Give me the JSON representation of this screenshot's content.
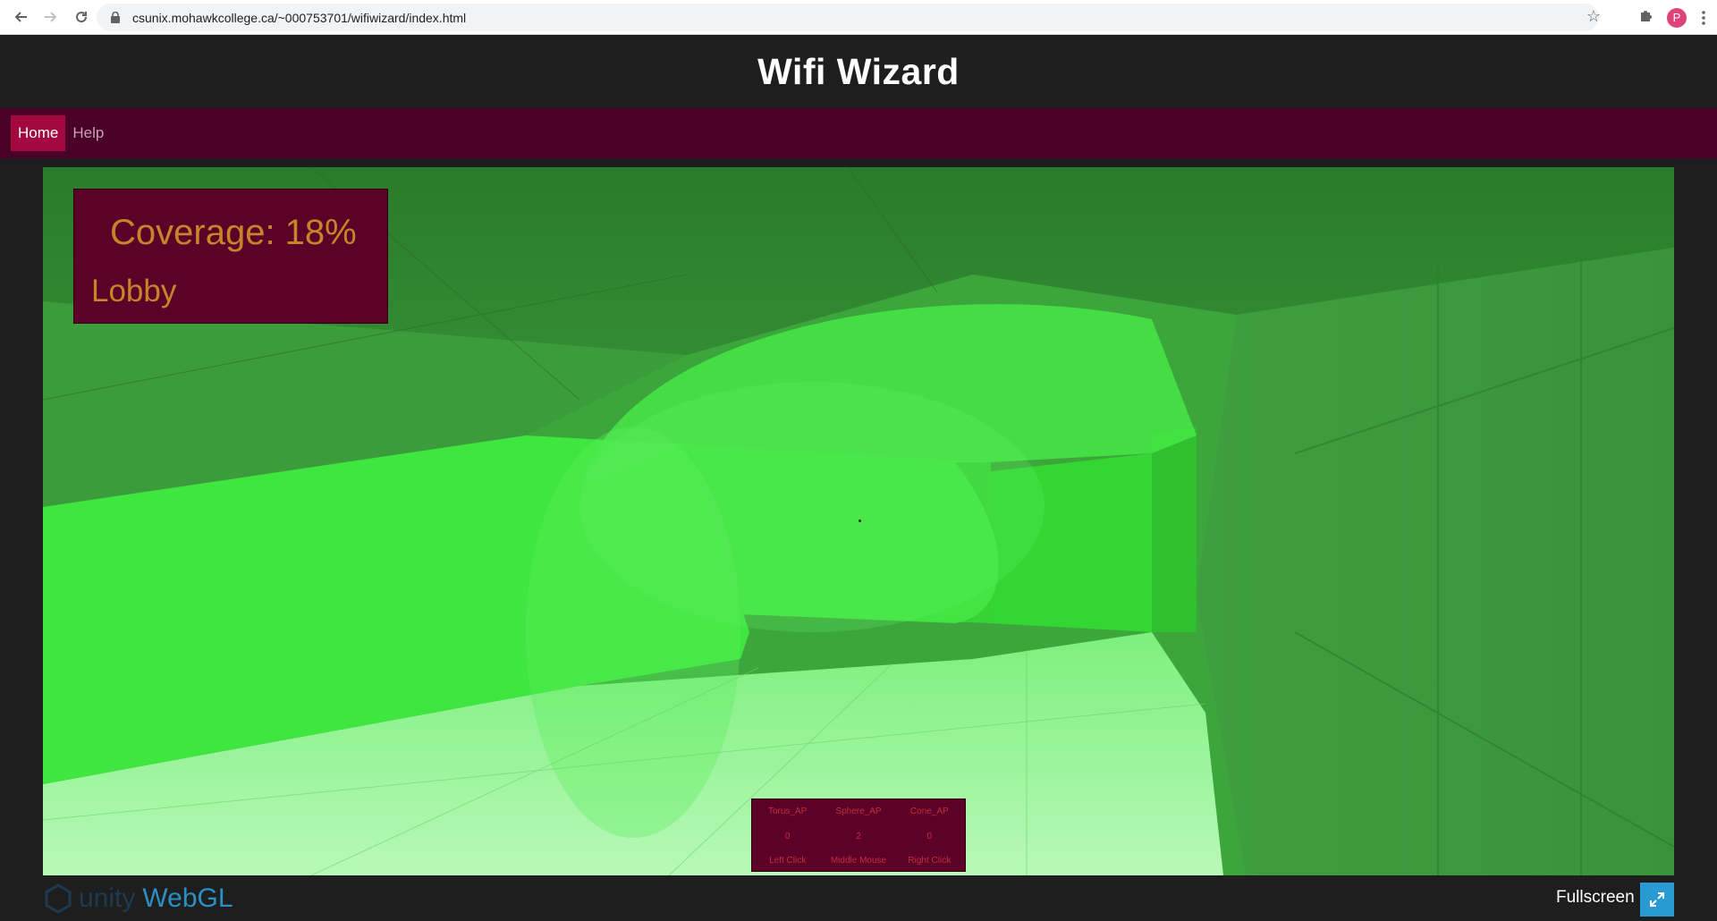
{
  "browser": {
    "url": "csunix.mohawkcollege.ca/~000753701/wifiwizard/index.html",
    "avatar_letter": "P"
  },
  "site": {
    "title": "Wifi Wizard",
    "nav": [
      {
        "label": "Home",
        "active": true
      },
      {
        "label": "Help",
        "active": false
      }
    ]
  },
  "game": {
    "coverage": "Coverage: 18%",
    "room": "Lobby",
    "access_points": [
      {
        "name": "Torus_AP",
        "count": "0",
        "control": "Left Click"
      },
      {
        "name": "Sphere_AP",
        "count": "2",
        "control": "Middle Mouse"
      },
      {
        "name": "Cone_AP",
        "count": "0",
        "control": "Right Click"
      }
    ]
  },
  "footer": {
    "logo_unity": "unity",
    "logo_webgl": "WebGL",
    "fullscreen_label": "Fullscreen"
  },
  "colors": {
    "header_bg": "#1f1e1f",
    "nav_bg": "#4a0027",
    "nav_active": "#a3093f",
    "panel_bg": "#5c0128",
    "panel_text": "#c7852a",
    "ap_text": "#c0303a",
    "fullscreen_btn": "#2a9ad3"
  }
}
